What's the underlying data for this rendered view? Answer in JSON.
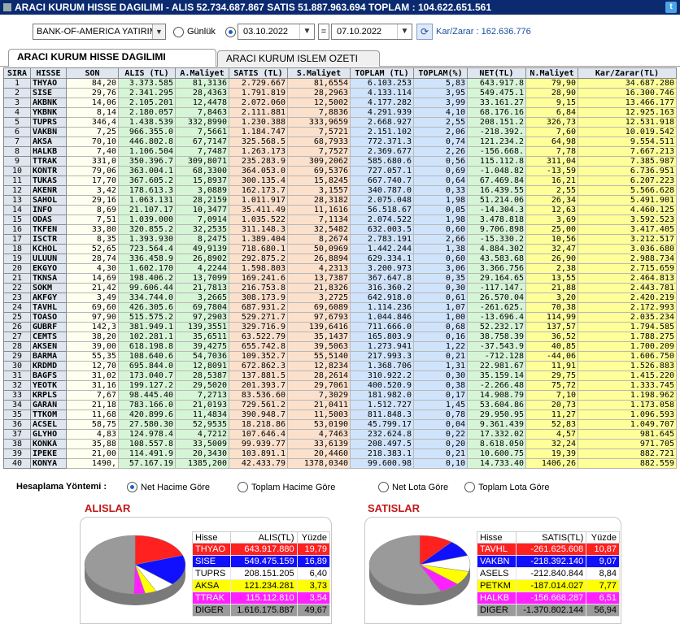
{
  "titlebar": {
    "text": "ARACI KURUM HISSE DAGILIMI  -  ALIS 52.734.687.867  SATIS 51.887.963.694  TOPLAM : 104.622.651.561"
  },
  "toolbar": {
    "broker_value": "BANK-OF-AMERICA YATIRIM",
    "gunluk_label": "Günlük",
    "date_from": "03.10.2022",
    "eq": "=",
    "date_to": "07.10.2022",
    "karzarar": "Kar/Zarar : 162.636.776"
  },
  "tabs": [
    {
      "label": "ARACI KURUM HISSE DAGILIMI"
    },
    {
      "label": "ARACI KURUM ISLEM OZETI"
    }
  ],
  "table": {
    "headers": [
      "SIRA",
      "HISSE",
      "SON",
      "ALIS (TL)",
      "A.Maliyet",
      "SATIS (TL)",
      "S.Maliyet",
      "TOPLAM (TL)",
      "TOPLAM(%)",
      "NET(TL)",
      "N.Maliyet",
      "Kar/Zarar(TL)"
    ],
    "rows": [
      [
        "1",
        "THYAO",
        "84,20",
        "3.373.585",
        "81,3136",
        "2.729.667",
        "81,6554",
        "6.103.253",
        "5,83",
        "643.917.8",
        "79,90",
        "34.687.280"
      ],
      [
        "2",
        "SISE",
        "29,76",
        "2.341.295",
        "28,4363",
        "1.791.819",
        "28,2963",
        "4.133.114",
        "3,95",
        "549.475.1",
        "28,90",
        "16.300.746"
      ],
      [
        "3",
        "AKBNK",
        "14,06",
        "2.105.201",
        "12,4478",
        "2.072.060",
        "12,5002",
        "4.177.282",
        "3,99",
        "33.161.27",
        "9,15",
        "13.466.177"
      ],
      [
        "4",
        "YKBNK",
        "8,14",
        "2.180.057",
        "7,8463",
        "2.111.881",
        "7,8836",
        "4.291.939",
        "4,10",
        "68.176.16",
        "6,84",
        "12.925.163"
      ],
      [
        "5",
        "TUPRS",
        "346,4",
        "1.438.539",
        "332,8990",
        "1.230.388",
        "333,9659",
        "2.668.927",
        "2,55",
        "208.151.2",
        "326,73",
        "12.531.918"
      ],
      [
        "6",
        "VAKBN",
        "7,25",
        "966.355.0",
        "7,5661",
        "1.184.747",
        "7,5721",
        "2.151.102",
        "2,06",
        "-218.392.",
        "7,60",
        "10.019.542"
      ],
      [
        "7",
        "AKSA",
        "70,10",
        "446.802.8",
        "67,7147",
        "325.568.5",
        "68,7933",
        "772.371.3",
        "0,74",
        "121.234.2",
        "64,98",
        "9.554.511"
      ],
      [
        "8",
        "HALKB",
        "7,40",
        "1.106.504",
        "7,7487",
        "1.263.173",
        "7,7527",
        "2.369.677",
        "2,26",
        "-156.668.",
        "7,78",
        "7.667.213"
      ],
      [
        "9",
        "TTRAK",
        "331,0",
        "350.396.7",
        "309,8071",
        "235.283.9",
        "309,2062",
        "585.680.6",
        "0,56",
        "115.112.8",
        "311,04",
        "7.385.987"
      ],
      [
        "10",
        "KONTR",
        "79,06",
        "363.004.1",
        "68,3300",
        "364.053.0",
        "69,5376",
        "727.057.1",
        "0,69",
        "-1.048.82",
        "-13,59",
        "6.736.951"
      ],
      [
        "11",
        "TUKAS",
        "17,70",
        "367.605.2",
        "15,8937",
        "300.135.4",
        "15,8245",
        "667.740.7",
        "0,64",
        "67.469.84",
        "16,21",
        "6.207.223"
      ],
      [
        "12",
        "AKENR",
        "3,42",
        "178.613.3",
        "3,0889",
        "162.173.7",
        "3,1557",
        "340.787.0",
        "0,33",
        "16.439.55",
        "2,55",
        "5.566.628"
      ],
      [
        "13",
        "SAHOL",
        "29,16",
        "1.063.131",
        "28,2159",
        "1.011.917",
        "28,3182",
        "2.075.048",
        "1,98",
        "51.214.06",
        "26,34",
        "5.491.901"
      ],
      [
        "14",
        "INFO",
        "8,69",
        "21.107.17",
        "10,3477",
        "35.411.49",
        "11,1616",
        "56.518.67",
        "0,05",
        "-14.304.3",
        "12,63",
        "4.460.125"
      ],
      [
        "15",
        "ODAS",
        "7,51",
        "1.039.000",
        "7,0914",
        "1.035.522",
        "7,1134",
        "2.074.522",
        "1,98",
        "3.478.818",
        "3,69",
        "3.592.523"
      ],
      [
        "16",
        "TKFEN",
        "33,80",
        "320.855.2",
        "32,2535",
        "311.148.3",
        "32,5482",
        "632.003.5",
        "0,60",
        "9.706.898",
        "25,00",
        "3.417.405"
      ],
      [
        "17",
        "ISCTR",
        "8,35",
        "1.393.930",
        "8,2475",
        "1.389.404",
        "8,2674",
        "2.783.191",
        "2,66",
        "-15.330.2",
        "10,56",
        "3.212.517"
      ],
      [
        "18",
        "KCHOL",
        "52,65",
        "723.564.4",
        "49,9139",
        "718.680.1",
        "50,0969",
        "1.442.244",
        "1,38",
        "4.884.302",
        "32,47",
        "3.036.680"
      ],
      [
        "19",
        "ULUUN",
        "28,74",
        "336.458.9",
        "26,8902",
        "292.875.2",
        "26,8894",
        "629.334.1",
        "0,60",
        "43.583.68",
        "26,90",
        "2.988.734"
      ],
      [
        "20",
        "EKGYO",
        "4,30",
        "1.602.170",
        "4,2244",
        "1.598.803",
        "4,2313",
        "3.200.973",
        "3,06",
        "3.366.756",
        "2,38",
        "2.715.659"
      ],
      [
        "21",
        "TKNSA",
        "14,69",
        "198.406.2",
        "13,7099",
        "169.241.6",
        "13,7387",
        "367.647.8",
        "0,35",
        "29.164.65",
        "13,55",
        "2.464.813"
      ],
      [
        "22",
        "SOKM",
        "21,42",
        "99.606.44",
        "21,7813",
        "216.753.8",
        "21,8326",
        "316.360.2",
        "0,30",
        "-117.147.",
        "21,88",
        "2.443.781"
      ],
      [
        "23",
        "AKFGY",
        "3,49",
        "334.744.0",
        "3,2665",
        "308.173.9",
        "3,2725",
        "642.918.0",
        "0,61",
        "26.570.04",
        "3,20",
        "2.420.219"
      ],
      [
        "24",
        "TAVHL",
        "69,60",
        "426.305.6",
        "69,7804",
        "687.931.2",
        "69,6089",
        "1.114.236",
        "1,07",
        "-261.625.",
        "70,38",
        "2.172.993"
      ],
      [
        "25",
        "TOASO",
        "97,90",
        "515.575.2",
        "97,2903",
        "529.271.7",
        "97,6793",
        "1.044.846",
        "1,00",
        "-13.696.4",
        "114,99",
        "2.035.234"
      ],
      [
        "26",
        "GUBRF",
        "142,3",
        "381.949.1",
        "139,3551",
        "329.716.9",
        "139,6416",
        "711.666.0",
        "0,68",
        "52.232.17",
        "137,57",
        "1.794.585"
      ],
      [
        "27",
        "CEMTS",
        "38,20",
        "102.281.1",
        "35,6511",
        "63.522.79",
        "35,1437",
        "165.803.9",
        "0,16",
        "38.758.39",
        "36,52",
        "1.788.275"
      ],
      [
        "28",
        "AKSEN",
        "39,00",
        "618.198.8",
        "39,4275",
        "655.742.8",
        "39,5063",
        "1.273.941",
        "1,22",
        "-37.543.9",
        "40,85",
        "1.700.209"
      ],
      [
        "29",
        "BARMA",
        "55,35",
        "108.640.6",
        "54,7036",
        "109.352.7",
        "55,5140",
        "217.993.3",
        "0,21",
        "-712.128",
        "-44,06",
        "1.606.750"
      ],
      [
        "30",
        "KRDMD",
        "12,70",
        "695.844.0",
        "12,8091",
        "672.862.3",
        "12,8234",
        "1.368.706",
        "1,31",
        "22.981.67",
        "11,91",
        "1.526.883"
      ],
      [
        "31",
        "BAGFS",
        "31,02",
        "173.040.7",
        "28,5387",
        "137.881.5",
        "28,2614",
        "310.922.2",
        "0,30",
        "35.159.14",
        "29,75",
        "1.415.220"
      ],
      [
        "32",
        "YEOTK",
        "31,16",
        "199.127.2",
        "29,5020",
        "201.393.7",
        "29,7061",
        "400.520.9",
        "0,38",
        "-2.266.48",
        "75,72",
        "1.333.745"
      ],
      [
        "33",
        "KRPLS",
        "7,67",
        "98.445.40",
        "7,2713",
        "83.536.60",
        "7,3029",
        "181.982.0",
        "0,17",
        "14.908.79",
        "7,10",
        "1.198.962"
      ],
      [
        "34",
        "GARAN",
        "21,18",
        "783.166.0",
        "21,0193",
        "729.561.2",
        "21,0411",
        "1.512.727",
        "1,45",
        "53.604.86",
        "20,73",
        "1.173.058"
      ],
      [
        "35",
        "TTKOM",
        "11,68",
        "420.899.6",
        "11,4834",
        "390.948.7",
        "11,5003",
        "811.848.3",
        "0,78",
        "29.950.95",
        "11,27",
        "1.096.593"
      ],
      [
        "36",
        "ACSEL",
        "58,75",
        "27.580.30",
        "52,9535",
        "18.218.86",
        "53,0190",
        "45.799.17",
        "0,04",
        "9.361.439",
        "52,83",
        "1.049.707"
      ],
      [
        "37",
        "GLYHO",
        "4,83",
        "124.978.4",
        "4,7212",
        "107.646.4",
        "4,7463",
        "232.624.8",
        "0,22",
        "17.332.02",
        "4,57",
        "981.645"
      ],
      [
        "38",
        "KONKA",
        "35,88",
        "108.557.8",
        "33,5009",
        "99.939.77",
        "33,6139",
        "208.497.5",
        "0,20",
        "8.618.050",
        "32,24",
        "971.705"
      ],
      [
        "39",
        "IPEKE",
        "21,00",
        "114.491.9",
        "20,3430",
        "103.891.1",
        "20,4460",
        "218.383.1",
        "0,21",
        "10.600.75",
        "19,39",
        "882.721"
      ],
      [
        "40",
        "KONYA",
        "1490,",
        "57.167.19",
        "1385,200",
        "42.433.79",
        "1378,0340",
        "99.600.98",
        "0,10",
        "14.733.40",
        "1406,26",
        "882.559"
      ]
    ]
  },
  "method": {
    "title": "Hesaplama Yöntemi :",
    "options": [
      {
        "label": "Net Hacime Göre",
        "selected": true
      },
      {
        "label": "Toplam Hacime Göre",
        "selected": false
      },
      {
        "label": "Net Lota Göre",
        "selected": false
      },
      {
        "label": "Toplam Lota Göre",
        "selected": false
      }
    ]
  },
  "alislar": {
    "title": "ALISLAR",
    "headers": [
      "Hisse",
      "ALIS(TL)",
      "Yüzde"
    ],
    "rows": [
      {
        "hisse": "THYAO",
        "value": "643.917.880",
        "pct": "19,79",
        "pct_num": 19.79,
        "color": "#ff2020",
        "text": "#ffffff"
      },
      {
        "hisse": "SISE",
        "value": "549.475.159",
        "pct": "16,89",
        "pct_num": 16.89,
        "color": "#1010ff",
        "text": "#ffffff"
      },
      {
        "hisse": "TUPRS",
        "value": "208.151.205",
        "pct": "6,40",
        "pct_num": 6.4,
        "color": "#ffffff",
        "text": "#000000"
      },
      {
        "hisse": "AKSA",
        "value": "121.234.281",
        "pct": "3,73",
        "pct_num": 3.73,
        "color": "#ffff00",
        "text": "#000000"
      },
      {
        "hisse": "TTRAK",
        "value": "115.112.810",
        "pct": "3,54",
        "pct_num": 3.54,
        "color": "#ff20ff",
        "text": "#ffffff"
      },
      {
        "hisse": "DIGER",
        "value": "1.616.175.887",
        "pct": "49,67",
        "pct_num": 49.67,
        "color": "#9a9a9a",
        "text": "#000000"
      }
    ]
  },
  "satislar": {
    "title": "SATISLAR",
    "headers": [
      "Hisse",
      "SATIS(TL)",
      "Yüzde"
    ],
    "rows": [
      {
        "hisse": "TAVHL",
        "value": "-261.625.608",
        "pct": "10,87",
        "pct_num": 10.87,
        "color": "#ff2020",
        "text": "#ffffff"
      },
      {
        "hisse": "VAKBN",
        "value": "-218.392.140",
        "pct": "9,07",
        "pct_num": 9.07,
        "color": "#1010ff",
        "text": "#ffffff"
      },
      {
        "hisse": "ASELS",
        "value": "-212.840.844",
        "pct": "8,84",
        "pct_num": 8.84,
        "color": "#ffffff",
        "text": "#000000"
      },
      {
        "hisse": "PETKM",
        "value": "-187.014.027",
        "pct": "7,77",
        "pct_num": 7.77,
        "color": "#ffff00",
        "text": "#000000"
      },
      {
        "hisse": "HALKB",
        "value": "-156.668.287",
        "pct": "6,51",
        "pct_num": 6.51,
        "color": "#ff20ff",
        "text": "#ffffff"
      },
      {
        "hisse": "DIGER",
        "value": "-1.370.802.144",
        "pct": "56,94",
        "pct_num": 56.94,
        "color": "#9a9a9a",
        "text": "#000000"
      }
    ]
  }
}
